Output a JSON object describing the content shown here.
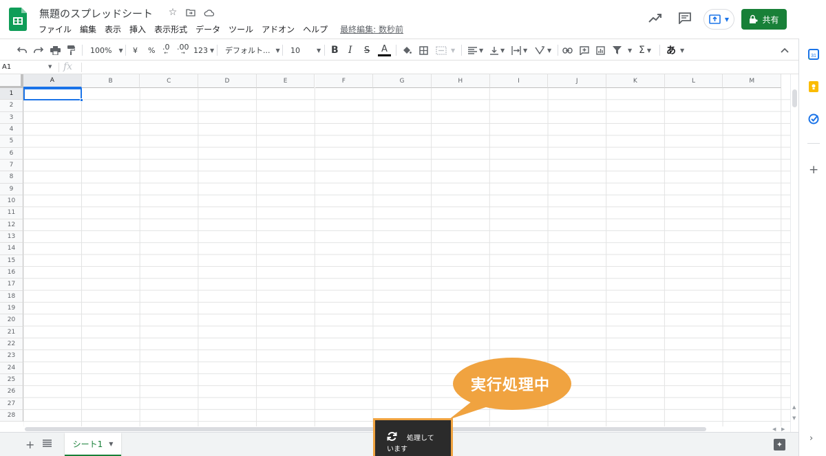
{
  "document": {
    "title": "無題のスプレッドシート",
    "last_edit": "最終編集: 数秒前"
  },
  "menu": [
    "ファイル",
    "編集",
    "表示",
    "挿入",
    "表示形式",
    "データ",
    "ツール",
    "アドオン",
    "ヘルプ"
  ],
  "header": {
    "share_label": "共有"
  },
  "toolbar": {
    "zoom": "100%",
    "currency": "¥",
    "percent": "%",
    "dec_decrease": ".0",
    "dec_increase": ".00",
    "number_format": "123",
    "font": "デフォルト...",
    "font_size": "10",
    "bold": "B",
    "italic": "I",
    "strike": "S",
    "text_color": "A",
    "input_tools": "あ"
  },
  "formula_bar": {
    "name_box": "A1",
    "fx": "fx"
  },
  "columns": [
    "A",
    "B",
    "C",
    "D",
    "E",
    "F",
    "G",
    "H",
    "I",
    "J",
    "K",
    "L",
    "M"
  ],
  "rows": [
    "1",
    "2",
    "3",
    "4",
    "5",
    "6",
    "7",
    "8",
    "9",
    "10",
    "11",
    "12",
    "13",
    "14",
    "15",
    "16",
    "17",
    "18",
    "19",
    "20",
    "21",
    "22",
    "23",
    "24",
    "25",
    "26",
    "27",
    "28"
  ],
  "selected_cell": "A1",
  "sheets": [
    {
      "name": "シート1",
      "active": true
    }
  ],
  "toast": {
    "line1": "処理して",
    "line2": "います"
  },
  "callout": {
    "text": "実行処理中"
  },
  "colors": {
    "accent": "#1a73e8",
    "share_green": "#188038",
    "callout_orange": "#f0a340",
    "toast_bg": "#2b2b2b"
  }
}
